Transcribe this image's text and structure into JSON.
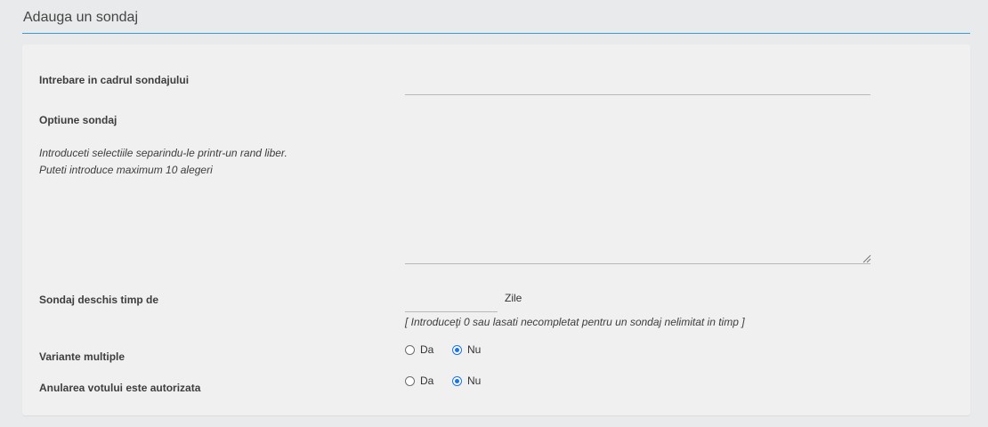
{
  "header": {
    "title": "Adauga un sondaj"
  },
  "form": {
    "question": {
      "label": "Intrebare in cadrul sondajului",
      "value": ""
    },
    "options": {
      "label": "Optiune sondaj",
      "hint_line1": "Introduceti selectiile separindu-le printr-un rand liber.",
      "hint_line2": "Puteti introduce maximum 10 alegeri",
      "value": ""
    },
    "duration": {
      "label": "Sondaj deschis timp de",
      "value": "",
      "unit": "Zile",
      "hint": "[ Introduceţi 0 sau lasati necompletat pentru un sondaj nelimitat in timp ]"
    },
    "multiple": {
      "label": "Variante multiple",
      "options": [
        {
          "label": "Da",
          "checked": false
        },
        {
          "label": "Nu",
          "checked": true
        }
      ]
    },
    "vote_cancel": {
      "label": "Anularea votului este autorizata",
      "options": [
        {
          "label": "Da",
          "checked": false
        },
        {
          "label": "Nu",
          "checked": true
        }
      ]
    }
  },
  "colors": {
    "accent": "#1a73e8",
    "header_line": "#3a9bd9"
  }
}
